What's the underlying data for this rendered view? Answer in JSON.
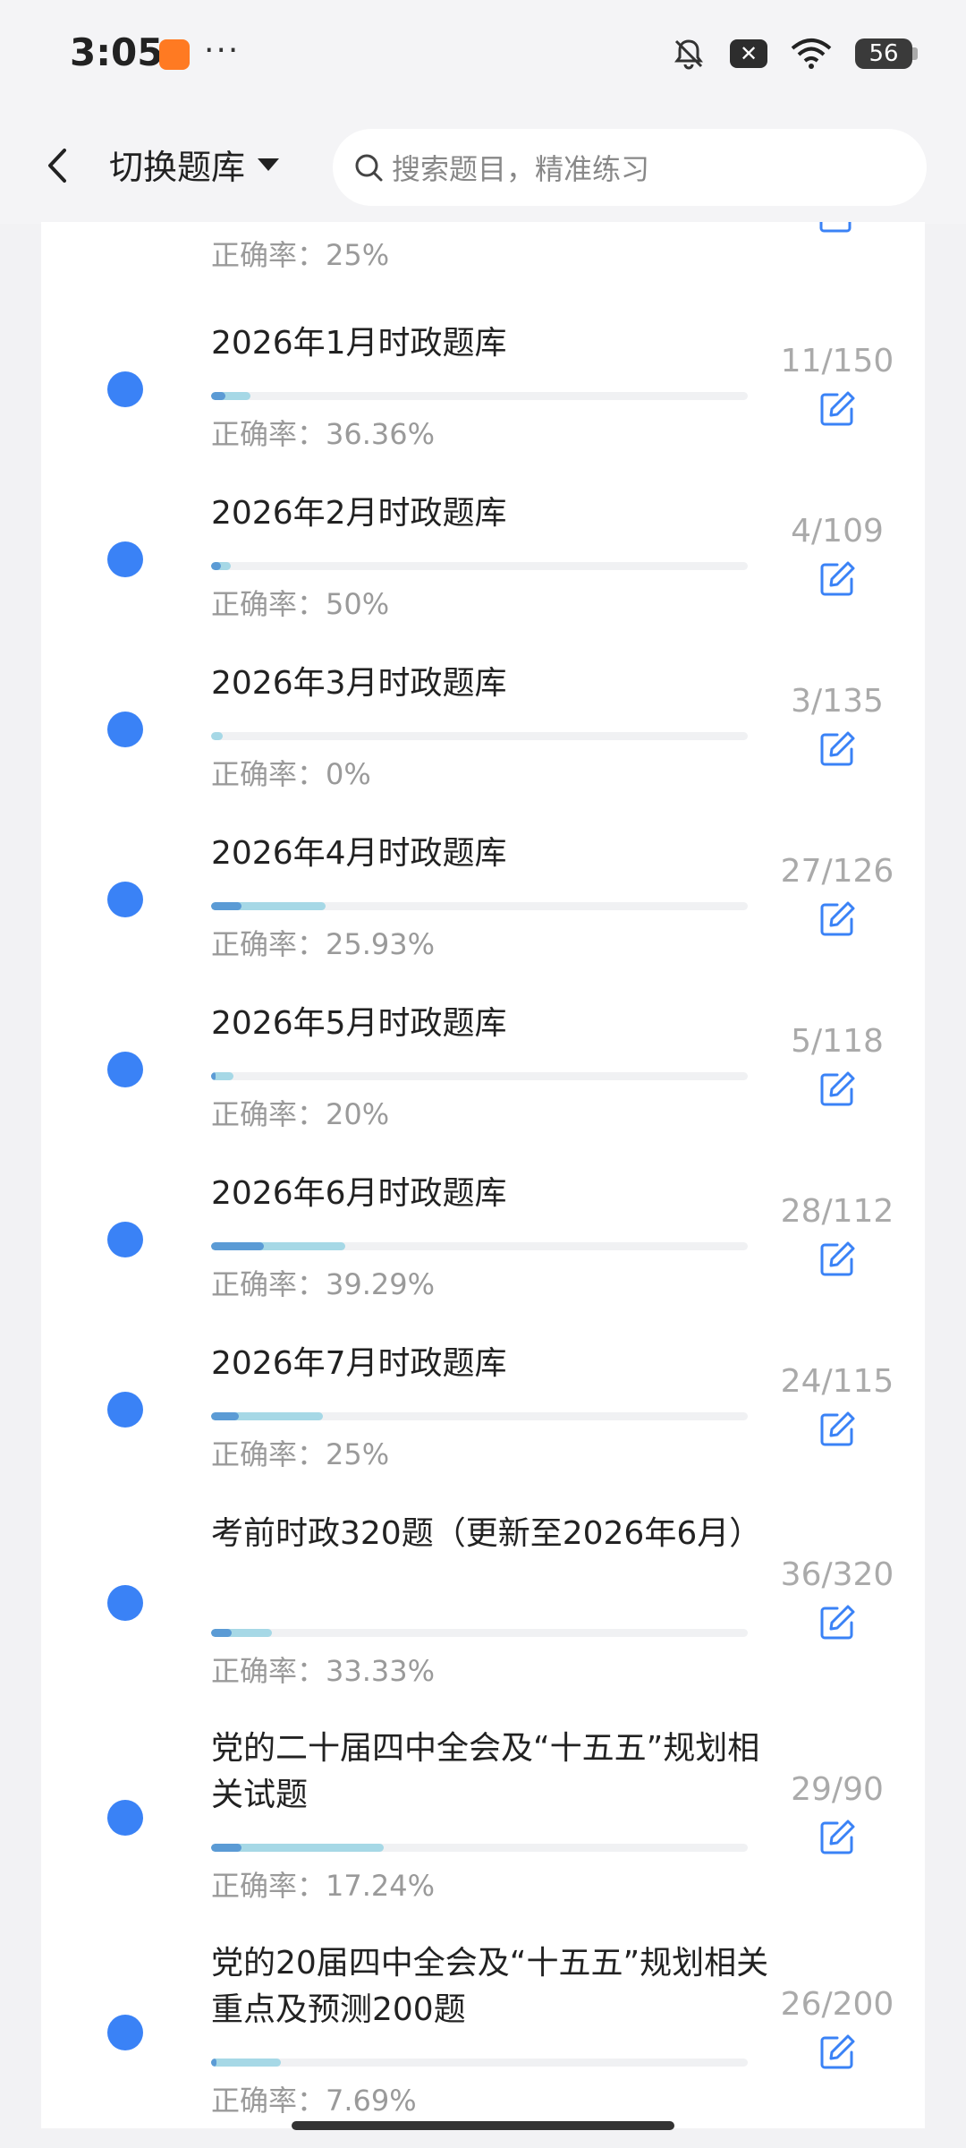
{
  "status_bar": {
    "time": "3:05",
    "more_dots": "···",
    "close_badge": "✕",
    "battery": "56"
  },
  "header": {
    "switch_label": "切换题库",
    "search_placeholder": "搜索题目，精准练习"
  },
  "top_partial_item": {
    "accuracy": "正确率：25%"
  },
  "items": [
    {
      "title": "2026年1月时政题库",
      "count": "11/150",
      "accuracy": "正确率：36.36%",
      "progress": 0.073,
      "correct": 0.027
    },
    {
      "title": "2026年2月时政题库",
      "count": "4/109",
      "accuracy": "正确率：50%",
      "progress": 0.037,
      "correct": 0.018
    },
    {
      "title": "2026年3月时政题库",
      "count": "3/135",
      "accuracy": "正确率：0%",
      "progress": 0.022,
      "correct": 0.0
    },
    {
      "title": "2026年4月时政题库",
      "count": "27/126",
      "accuracy": "正确率：25.93%",
      "progress": 0.214,
      "correct": 0.056
    },
    {
      "title": "2026年5月时政题库",
      "count": "5/118",
      "accuracy": "正确率：20%",
      "progress": 0.042,
      "correct": 0.008
    },
    {
      "title": "2026年6月时政题库",
      "count": "28/112",
      "accuracy": "正确率：39.29%",
      "progress": 0.25,
      "correct": 0.098
    },
    {
      "title": "2026年7月时政题库",
      "count": "24/115",
      "accuracy": "正确率：25%",
      "progress": 0.209,
      "correct": 0.052
    },
    {
      "title": "考前时政320题（更新至2026年6月）",
      "count": "36/320",
      "accuracy": "正确率：33.33%",
      "progress": 0.1125,
      "correct": 0.0375
    },
    {
      "title": "党的二十届四中全会及“十五五”规划相关试题",
      "count": "29/90",
      "accuracy": "正确率：17.24%",
      "progress": 0.322,
      "correct": 0.056
    },
    {
      "title": "党的20届四中全会及“十五五”规划相关重点及预测200题",
      "count": "26/200",
      "accuracy": "正确率：7.69%",
      "progress": 0.13,
      "correct": 0.01
    }
  ],
  "colors": {
    "dot": "#3a82f6",
    "bar_bg": "#f0f1f3",
    "bar_attempted": "#a6d8e6",
    "bar_correct": "#5b9bd5",
    "edit_icon": "#3a82f6"
  }
}
